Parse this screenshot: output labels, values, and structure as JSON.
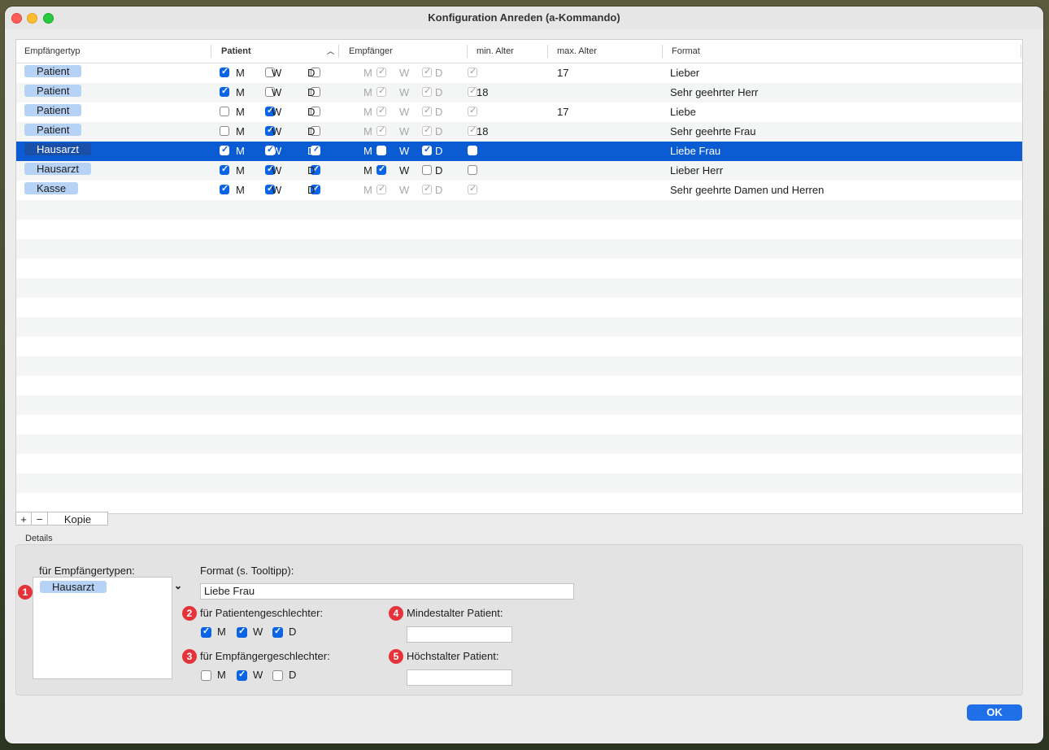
{
  "window": {
    "title": "Konfiguration Anreden (a-Kommando)"
  },
  "table": {
    "columns": {
      "empfaengertyp": "Empfängertyp",
      "patient": "Patient",
      "empfaenger": "Empfänger",
      "min_alter": "min. Alter",
      "max_alter": "max. Alter",
      "format": "Format"
    },
    "rows": [
      {
        "typ": "Patient",
        "p": [
          true,
          false,
          false
        ],
        "e": [
          true,
          true,
          true
        ],
        "e_disabled": true,
        "min": "",
        "max": "17",
        "format": "Lieber"
      },
      {
        "typ": "Patient",
        "p": [
          true,
          false,
          false
        ],
        "e": [
          true,
          true,
          true
        ],
        "e_disabled": true,
        "min": "18",
        "max": "",
        "format": "Sehr geehrter Herr"
      },
      {
        "typ": "Patient",
        "p": [
          false,
          true,
          false
        ],
        "e": [
          true,
          true,
          true
        ],
        "e_disabled": true,
        "min": "",
        "max": "17",
        "format": "Liebe"
      },
      {
        "typ": "Patient",
        "p": [
          false,
          true,
          false
        ],
        "e": [
          true,
          true,
          true
        ],
        "e_disabled": true,
        "min": "18",
        "max": "",
        "format": "Sehr geehrte Frau"
      },
      {
        "typ": "Hausarzt",
        "p": [
          true,
          true,
          true
        ],
        "e": [
          false,
          true,
          false
        ],
        "e_disabled": false,
        "min": "",
        "max": "",
        "format": "Liebe Frau",
        "selected": true
      },
      {
        "typ": "Hausarzt",
        "p": [
          true,
          true,
          true
        ],
        "e": [
          true,
          false,
          false
        ],
        "e_disabled": false,
        "min": "",
        "max": "",
        "format": "Lieber Herr"
      },
      {
        "typ": "Kasse",
        "p": [
          true,
          true,
          true
        ],
        "e": [
          true,
          true,
          true
        ],
        "e_disabled": true,
        "min": "",
        "max": "",
        "format": "Sehr geehrte Damen und Herren"
      }
    ],
    "gender_labels": [
      "M",
      "W",
      "D"
    ]
  },
  "toolbar": {
    "add": "+",
    "remove": "−",
    "copy": "Kopie"
  },
  "details": {
    "title": "Details",
    "recipient_types_label": "für Empfängertypen:",
    "recipient_types": [
      "Hausarzt"
    ],
    "format_label": "Format (s. Tooltipp):",
    "format_value": "Liebe Frau",
    "patient_gender_label": "für Patientengeschlechter:",
    "patient_gender": [
      true,
      true,
      true
    ],
    "recipient_gender_label": "für Empfängergeschlechter:",
    "recipient_gender": [
      false,
      true,
      false
    ],
    "min_age_label": "Mindestalter Patient:",
    "min_age_value": "",
    "max_age_label": "Höchstalter Patient:",
    "max_age_value": "",
    "badges": [
      "1",
      "2",
      "3",
      "4",
      "5"
    ]
  },
  "ok_label": "OK"
}
